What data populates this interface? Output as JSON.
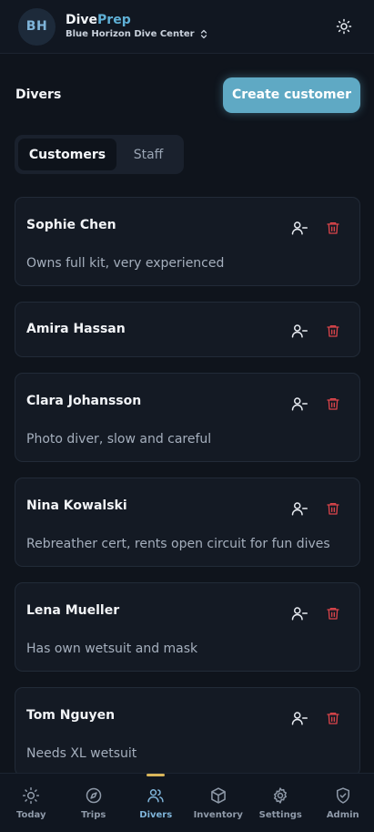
{
  "header": {
    "avatar_initials": "BH",
    "brand_primary": "Dive",
    "brand_accent": "Prep",
    "center_name": "Blue Horizon Dive Center"
  },
  "page": {
    "title": "Divers",
    "create_label": "Create customer"
  },
  "tabs": [
    {
      "label": "Customers",
      "active": true
    },
    {
      "label": "Staff",
      "active": false
    }
  ],
  "customers": [
    {
      "name": "Sophie Chen",
      "note": "Owns full kit, very experienced"
    },
    {
      "name": "Amira Hassan",
      "note": ""
    },
    {
      "name": "Clara Johansson",
      "note": "Photo diver, slow and careful"
    },
    {
      "name": "Nina Kowalski",
      "note": "Rebreather cert, rents open circuit for fun dives"
    },
    {
      "name": "Lena Mueller",
      "note": "Has own wetsuit and mask"
    },
    {
      "name": "Tom Nguyen",
      "note": "Needs XL wetsuit"
    }
  ],
  "nav": [
    {
      "label": "Today",
      "icon": "sun-icon",
      "active": false
    },
    {
      "label": "Trips",
      "icon": "compass-icon",
      "active": false
    },
    {
      "label": "Divers",
      "icon": "users-icon",
      "active": true
    },
    {
      "label": "Inventory",
      "icon": "box-icon",
      "active": false
    },
    {
      "label": "Settings",
      "icon": "gear-icon",
      "active": false
    },
    {
      "label": "Admin",
      "icon": "shield-check-icon",
      "active": false
    }
  ],
  "colors": {
    "accent": "#5fa9c4",
    "danger": "#d9444a",
    "active_indicator": "#d9b55a"
  }
}
